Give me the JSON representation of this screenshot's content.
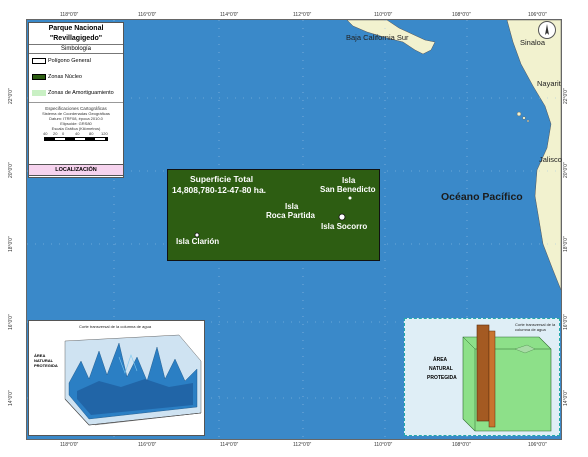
{
  "map": {
    "grid_lon_labels": [
      "118°0'0\"",
      "116°0'0\"",
      "114°0'0\"",
      "112°0'0\"",
      "110°0'0\"",
      "108°0'0\"",
      "106°0'0\""
    ],
    "grid_lat_labels": [
      "22°0'0\"",
      "20°0'0\"",
      "18°0'0\"",
      "16°0'0\"",
      "14°0'0\""
    ],
    "ocean_label": "Océano Pacífico",
    "places": {
      "baja": "Baja California Sur",
      "sinaloa": "Sinaloa",
      "nayarit": "Nayarit",
      "jalisco": "Jalisco"
    },
    "polygon": {
      "total_title": "Superficie Total",
      "total_value": "14,808,780-12-47-80  ha.",
      "clarion": "Isla Clarión",
      "roca_1": "Isla",
      "roca_2": "Roca Partida",
      "san_benedicto_1": "Isla",
      "san_benedicto_2": "San Benedicto",
      "socorro": "Isla Socorro"
    },
    "colors": {
      "ocean": "#3a89c9",
      "polygon_fill": "#2d5d12",
      "land": "#f2f2cf",
      "buffer_zone": "#c9f0c4",
      "localizacion": "#f6d3ee"
    }
  },
  "legend": {
    "title_1": "Parque Nacional",
    "title_2": "\"Revillagigedo\"",
    "simbologia": "Simbología",
    "poligono": "Polígono General",
    "nucleo": "Zonas Núcleo",
    "amortiguamiento": "Zonas de Amortiguamiento",
    "spec_title": "Especificaciones Cartográficas",
    "spec_1": "Sistema de Coordenadas Geográficas",
    "spec_2": "Datum: ITRF08, época 2010.0",
    "spec_3": "Elipsoide: GRS80",
    "spec_4": "Escala Gráfica (Kilómetros)",
    "scale_ticks": [
      "40",
      "20",
      "0",
      "40",
      "80",
      "120"
    ],
    "localizacion": "LOCALIZACIÓN"
  },
  "insets": {
    "left_title": "Corte transversal de la columna de agua",
    "left_side": "ÁREA NATURAL PROTEGIDA",
    "right_title": "Corte transversal de la columna de agua",
    "right_area_1": "ÁREA",
    "right_area_2": "NATURAL",
    "right_area_3": "PROTEGIDA"
  }
}
